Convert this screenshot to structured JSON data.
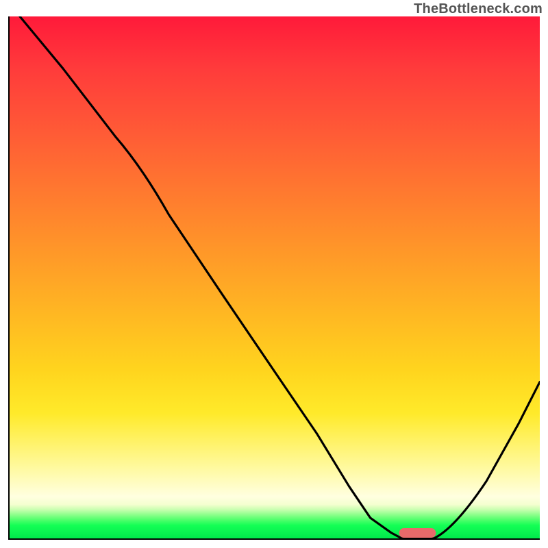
{
  "watermark": "TheBottleneck.com",
  "chart_data": {
    "type": "line",
    "title": "",
    "xlabel": "",
    "ylabel": "",
    "xlim": [
      0,
      100
    ],
    "ylim": [
      0,
      100
    ],
    "series": [
      {
        "name": "curve",
        "x": [
          2,
          10,
          20,
          25,
          30,
          40,
          50,
          58,
          64,
          68,
          72,
          74,
          80,
          84,
          90,
          96,
          100
        ],
        "values": [
          100,
          90,
          77,
          71,
          62,
          47,
          32,
          20,
          10,
          4,
          1,
          0,
          0,
          2,
          11,
          22,
          30
        ]
      }
    ],
    "marker": {
      "shape": "capsule",
      "x_center": 77,
      "y": 0,
      "width": 7,
      "height": 1.5,
      "color": "#e86a6a"
    },
    "background_gradient": {
      "type": "vertical",
      "stops": [
        {
          "pos": 0,
          "color": "#ff1a3a"
        },
        {
          "pos": 0.46,
          "color": "#ff9a28"
        },
        {
          "pos": 0.76,
          "color": "#ffea2a"
        },
        {
          "pos": 0.92,
          "color": "#ffffe0"
        },
        {
          "pos": 1.0,
          "color": "#00e84c"
        }
      ]
    },
    "axes": {
      "left": true,
      "bottom": true,
      "ticks": false,
      "grid": false
    }
  }
}
